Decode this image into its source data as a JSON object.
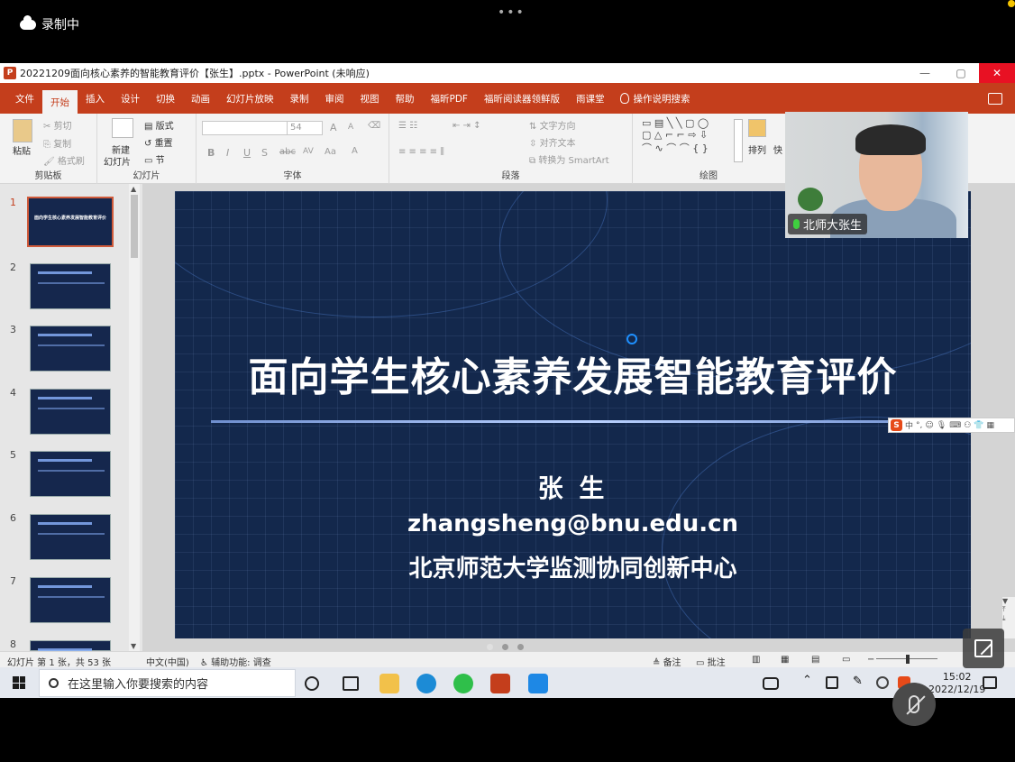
{
  "recording": {
    "label": "录制中"
  },
  "window": {
    "title": "20221209面向核心素养的智能教育评价【张生】.pptx - PowerPoint (未响应)",
    "app_icon_letter": "P"
  },
  "ribbon_tabs": [
    "文件",
    "开始",
    "插入",
    "设计",
    "切换",
    "动画",
    "幻灯片放映",
    "录制",
    "审阅",
    "视图",
    "帮助",
    "福昕PDF",
    "福昕阅读器领鲜版",
    "雨课堂"
  ],
  "active_tab_index": 1,
  "tell_me": "操作说明搜索",
  "ribbon": {
    "clipboard": {
      "label": "剪贴板",
      "paste": "粘贴",
      "cut": "剪切",
      "copy": "复制",
      "format_painter": "格式刷"
    },
    "slides": {
      "label": "幻灯片",
      "new_slide": "新建",
      "new_slide2": "幻灯片",
      "layout": "版式",
      "reset": "重置",
      "section": "节"
    },
    "font": {
      "label": "字体",
      "size": "54",
      "bold": "B",
      "italic": "I",
      "underline": "U",
      "strike": "S",
      "spacing": "AV",
      "case": "Aa",
      "grow": "A",
      "shrink": "A"
    },
    "paragraph": {
      "label": "段落",
      "text_direction": "文字方向",
      "align_text": "对齐文本",
      "smartart": "转换为 SmartArt"
    },
    "drawing": {
      "label": "绘图",
      "arrange": "排列",
      "quick": "快"
    }
  },
  "slides": [
    {
      "num": "1",
      "title": "面向学生核心素养发展智能教育评价"
    },
    {
      "num": "2"
    },
    {
      "num": "3"
    },
    {
      "num": "4"
    },
    {
      "num": "5"
    },
    {
      "num": "6"
    },
    {
      "num": "7"
    },
    {
      "num": "8"
    }
  ],
  "current_slide": {
    "title": "面向学生核心素养发展智能教育评价",
    "author": "张 生",
    "email": "zhangsheng@bnu.edu.cn",
    "org": "北京师范大学监测协同创新中心"
  },
  "ime": {
    "logo": "S",
    "mode": "中"
  },
  "camera": {
    "name": "北师大张生"
  },
  "status": {
    "slide_info": "幻灯片 第 1 张，共 53 张",
    "language": "中文(中国)",
    "accessibility": "辅助功能: 调查",
    "notes": "备注",
    "comments": "批注"
  },
  "taskbar": {
    "search_placeholder": "在这里输入你要搜索的内容",
    "time": "15:02",
    "date": "2022/12/19"
  },
  "colors": {
    "accent": "#c43e1c",
    "slide_bg": "#13284c",
    "taskbar": "#e4e8ef"
  }
}
